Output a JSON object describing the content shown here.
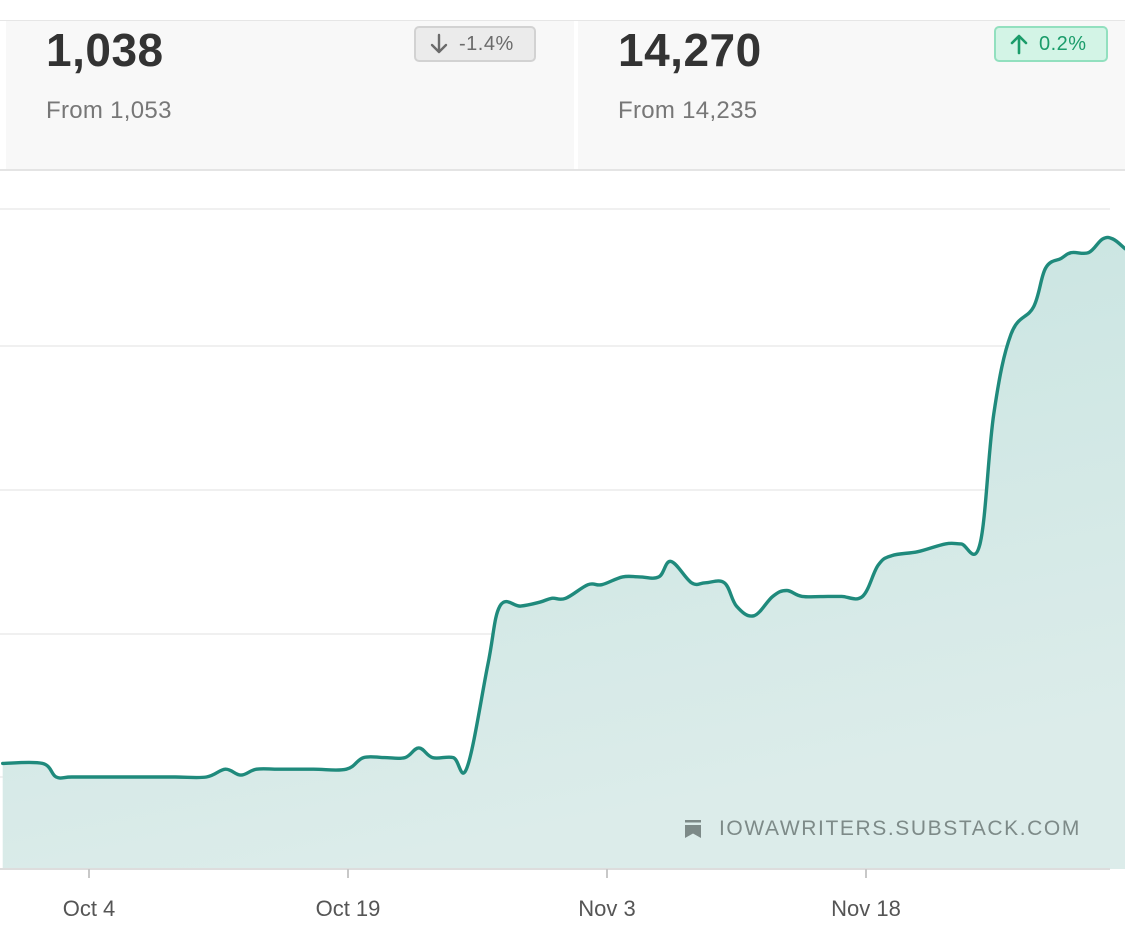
{
  "stats": [
    {
      "value": "1,038",
      "from": "From 1,053",
      "change": "-1.4%",
      "direction": "down",
      "icon": "arrow-down-icon"
    },
    {
      "value": "14,270",
      "from": "From 14,235",
      "change": "0.2%",
      "direction": "up",
      "icon": "arrow-up-icon"
    }
  ],
  "watermark": {
    "text": "IOWAWRITERS.SUBSTACK.COM",
    "icon": "bookmark-icon"
  },
  "colors": {
    "line": "#1f8a7c",
    "fill_top": "#c5e3df",
    "fill_bottom": "#dcecea",
    "grid": "#ececec",
    "badge_down_bg": "#ebebeb",
    "badge_up_bg": "#d3f4e6",
    "badge_up_text": "#1a9c6a"
  },
  "chart_data": {
    "type": "area",
    "title": "",
    "xlabel": "",
    "ylabel": "",
    "x_tick_labels": [
      "Oct 4",
      "Oct 19",
      "Nov 3",
      "Nov 18"
    ],
    "x_tick_days": [
      4,
      19,
      34,
      49
    ],
    "grid": true,
    "legend": "none",
    "y_axis_labels_visible": false,
    "series": [
      {
        "x": [
          -1,
          1.3,
          2.1,
          3,
          5,
          7,
          9,
          10.8,
          11.9,
          12.8,
          13.7,
          15,
          17,
          18.9,
          19.9,
          21.1,
          22.3,
          23.1,
          23.9,
          25.1,
          25.9,
          27.1,
          27.8,
          29,
          30.1,
          30.8,
          31.6,
          32.9,
          33.7,
          34.9,
          35.9,
          37,
          37.7,
          38.9,
          39.7,
          40.8,
          41.5,
          42.5,
          43.6,
          44.4,
          45.3,
          46.8,
          47.6,
          48.8,
          49.7,
          50.5,
          52,
          53.6,
          54.5,
          55.6,
          56.4,
          57.4,
          58.7,
          59.4,
          60.3,
          60.9,
          61.9,
          62.7,
          63.3,
          64.0
        ],
        "y": [
          95,
          95,
          88,
          88,
          88,
          88,
          88,
          88,
          92,
          89,
          92,
          92,
          92,
          92,
          98,
          98,
          98,
          103,
          98,
          98,
          93,
          146,
          176,
          176,
          178,
          180,
          180,
          187,
          187,
          191,
          191,
          191,
          199,
          188,
          188,
          188,
          176,
          171,
          181,
          184,
          181,
          181,
          181,
          181,
          197,
          202,
          204,
          208,
          208,
          208,
          275,
          316,
          330,
          350,
          355,
          358,
          358,
          365,
          365,
          360
        ]
      }
    ],
    "ylim": [
      68,
      368
    ]
  }
}
